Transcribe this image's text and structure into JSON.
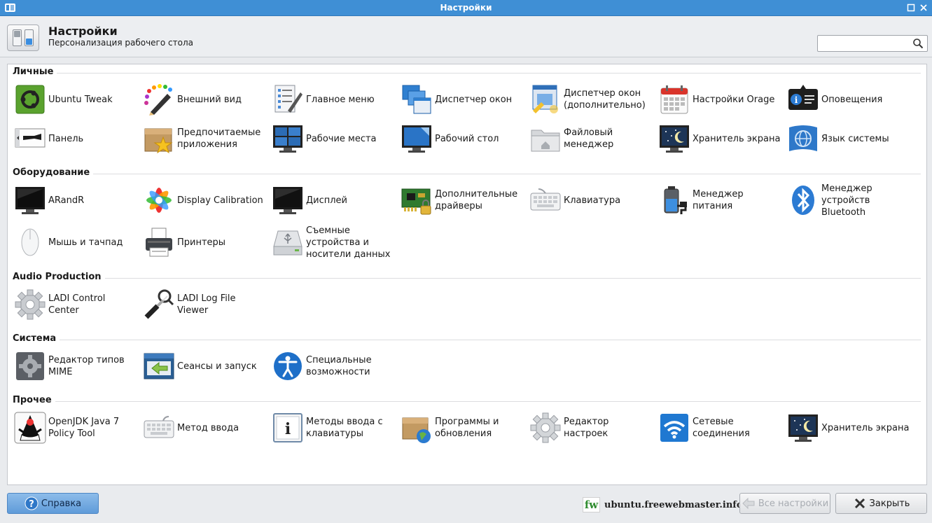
{
  "window": {
    "title": "Настройки"
  },
  "header": {
    "title": "Настройки",
    "subtitle": "Персонализация рабочего стола",
    "search": {
      "value": "",
      "placeholder": ""
    }
  },
  "sections": [
    {
      "title": "Личные",
      "items": [
        {
          "label": "Ubuntu Tweak",
          "icon": "ubuntu-tweak-icon"
        },
        {
          "label": "Внешний вид",
          "icon": "appearance-palette-icon"
        },
        {
          "label": "Главное меню",
          "icon": "menu-editor-icon"
        },
        {
          "label": "Диспетчер окон",
          "icon": "window-manager-icon"
        },
        {
          "label": "Диспетчер окон (дополнительно)",
          "icon": "window-manager-tweaks-icon"
        },
        {
          "label": "Настройки Orage",
          "icon": "calendar-icon"
        },
        {
          "label": "Оповещения",
          "icon": "notifications-icon"
        },
        {
          "label": "Панель",
          "icon": "panel-icon"
        },
        {
          "label": "Предпочитаемые приложения",
          "icon": "preferred-apps-icon"
        },
        {
          "label": "Рабочие места",
          "icon": "workspaces-icon"
        },
        {
          "label": "Рабочий стол",
          "icon": "desktop-icon"
        },
        {
          "label": "Файловый менеджер",
          "icon": "file-manager-icon"
        },
        {
          "label": "Хранитель экрана",
          "icon": "screensaver-icon"
        },
        {
          "label": "Язык системы",
          "icon": "language-globe-icon"
        }
      ]
    },
    {
      "title": "Оборудование",
      "items": [
        {
          "label": "ARandR",
          "icon": "monitor-icon"
        },
        {
          "label": "Display Calibration",
          "icon": "color-calibration-icon"
        },
        {
          "label": "Дисплей",
          "icon": "display-icon"
        },
        {
          "label": "Дополнительные драйверы",
          "icon": "drivers-chip-icon"
        },
        {
          "label": "Клавиатура",
          "icon": "keyboard-icon"
        },
        {
          "label": "Менеджер питания",
          "icon": "battery-power-icon"
        },
        {
          "label": "Менеджер устройств Bluetooth",
          "icon": "bluetooth-icon"
        },
        {
          "label": "Мышь и тачпад",
          "icon": "mouse-icon"
        },
        {
          "label": "Принтеры",
          "icon": "printer-icon"
        },
        {
          "label": "Съемные устройства и носители данных",
          "icon": "removable-drive-icon"
        }
      ]
    },
    {
      "title": "Audio Production",
      "items": [
        {
          "label": "LADI Control Center",
          "icon": "gear-icon"
        },
        {
          "label": "LADI Log File Viewer",
          "icon": "audio-jack-magnifier-icon"
        }
      ]
    },
    {
      "title": "Система",
      "items": [
        {
          "label": "Редактор типов MIME",
          "icon": "mime-gear-icon"
        },
        {
          "label": "Сеансы и запуск",
          "icon": "session-startup-icon"
        },
        {
          "label": "Специальные возможности",
          "icon": "accessibility-icon"
        }
      ]
    },
    {
      "title": "Прочее",
      "items": [
        {
          "label": "OpenJDK Java 7 Policy Tool",
          "icon": "java-duke-icon"
        },
        {
          "label": "Метод ввода",
          "icon": "input-keyboard-icon"
        },
        {
          "label": "Методы ввода с клавиатуры",
          "icon": "info-icon"
        },
        {
          "label": "Программы и обновления",
          "icon": "software-updates-icon"
        },
        {
          "label": "Редактор настроек",
          "icon": "settings-editor-gear-icon"
        },
        {
          "label": "Сетевые соединения",
          "icon": "wifi-icon"
        },
        {
          "label": "Хранитель экрана",
          "icon": "screensaver-icon"
        }
      ]
    }
  ],
  "footer": {
    "help_label": "Справка",
    "all_settings_label": "Все настройки",
    "close_label": "Закрыть",
    "watermark_logo": "fw",
    "watermark_text": "ubuntu.freewebmaster.info"
  },
  "colors": {
    "titlebar": "#3f8fd5",
    "help_button": "#6ea6df"
  }
}
